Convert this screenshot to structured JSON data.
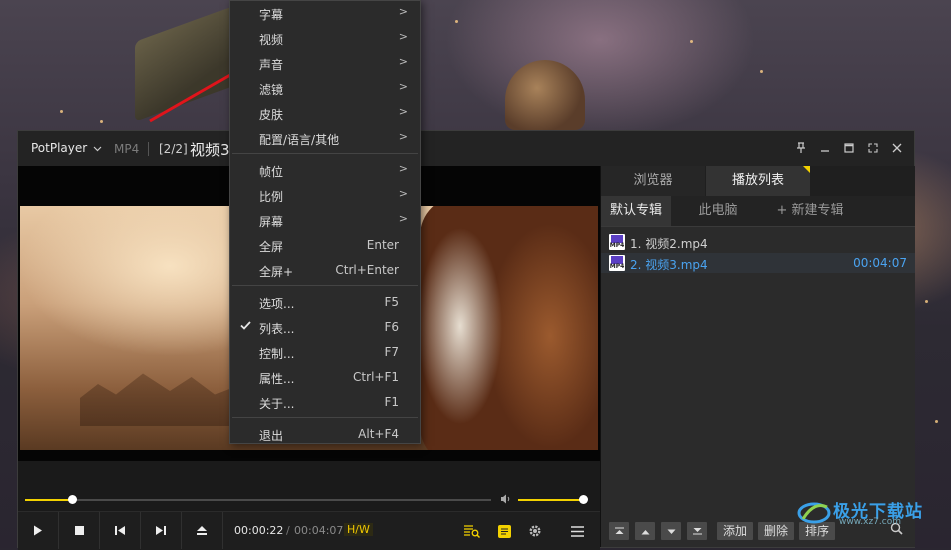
{
  "player": {
    "app_name": "PotPlayer",
    "format": "MP4",
    "index": "[2/2]",
    "file_title": "视频3"
  },
  "controls": {
    "time_current": "00:00:22",
    "time_separator": "/",
    "time_total": "00:04:07",
    "hw_badge": "H/W",
    "seek_progress": 0.1,
    "volume_level": 0.98
  },
  "playlist_panel": {
    "tabs": [
      "浏览器",
      "播放列表"
    ],
    "active_tab": "播放列表",
    "album_tabs": [
      "默认专辑",
      "此电脑",
      "+ 新建专辑"
    ],
    "items": [
      {
        "title": "1. 视频2.mp4",
        "duration": "",
        "active": false,
        "icon_label": "MP4"
      },
      {
        "title": "2. 视频3.mp4",
        "duration": "00:04:07",
        "active": true,
        "icon_label": "MP4"
      }
    ],
    "footer_buttons": [
      "添加",
      "删除",
      "排序"
    ]
  },
  "context_menu": {
    "items": [
      {
        "label": "字幕",
        "shortcut": "",
        "submenu": true
      },
      {
        "label": "视频",
        "shortcut": "",
        "submenu": true
      },
      {
        "label": "声音",
        "shortcut": "",
        "submenu": true
      },
      {
        "label": "滤镜",
        "shortcut": "",
        "submenu": true
      },
      {
        "label": "皮肤",
        "shortcut": "",
        "submenu": true
      },
      {
        "label": "配置/语言/其他",
        "shortcut": "",
        "submenu": true
      },
      {
        "label": "帧位",
        "shortcut": "",
        "submenu": true
      },
      {
        "label": "比例",
        "shortcut": "",
        "submenu": true
      },
      {
        "label": "屏幕",
        "shortcut": "",
        "submenu": true
      },
      {
        "label": "全屏",
        "shortcut": "Enter",
        "submenu": false
      },
      {
        "label": "全屏+",
        "shortcut": "Ctrl+Enter",
        "submenu": false
      },
      {
        "label": "选项...",
        "shortcut": "F5",
        "submenu": false
      },
      {
        "label": "列表...",
        "shortcut": "F6",
        "submenu": false,
        "checked": true
      },
      {
        "label": "控制...",
        "shortcut": "F7",
        "submenu": false
      },
      {
        "label": "属性...",
        "shortcut": "Ctrl+F1",
        "submenu": false
      },
      {
        "label": "关于...",
        "shortcut": "F1",
        "submenu": false
      },
      {
        "label": "退出",
        "shortcut": "Alt+F4",
        "submenu": false
      }
    ],
    "submenu_arrow": ">"
  },
  "watermark": {
    "text": "极光下载站",
    "sub": "www.xz7.com"
  },
  "colors": {
    "accent": "#f3d200",
    "active_item": "#4aa3f0",
    "annotation_arrow": "#e0141b",
    "icon_purple": "#5b3fc4"
  },
  "icons": {
    "app_menu": "chevron-down-icon",
    "pin": "pin-icon",
    "minimize": "minimize-icon",
    "maximize": "maximize-icon",
    "fullscreen": "fullscreen-icon",
    "close": "close-icon",
    "volume": "speaker-icon",
    "play": "play-icon",
    "stop": "stop-icon",
    "previous": "previous-icon",
    "next": "next-icon",
    "eject": "eject-icon",
    "subtitle_search": "subtitle-search-icon",
    "subtitle": "subtitle-icon",
    "settings": "gear-icon",
    "playlist_menu": "hamburger-icon",
    "check": "check-icon"
  }
}
